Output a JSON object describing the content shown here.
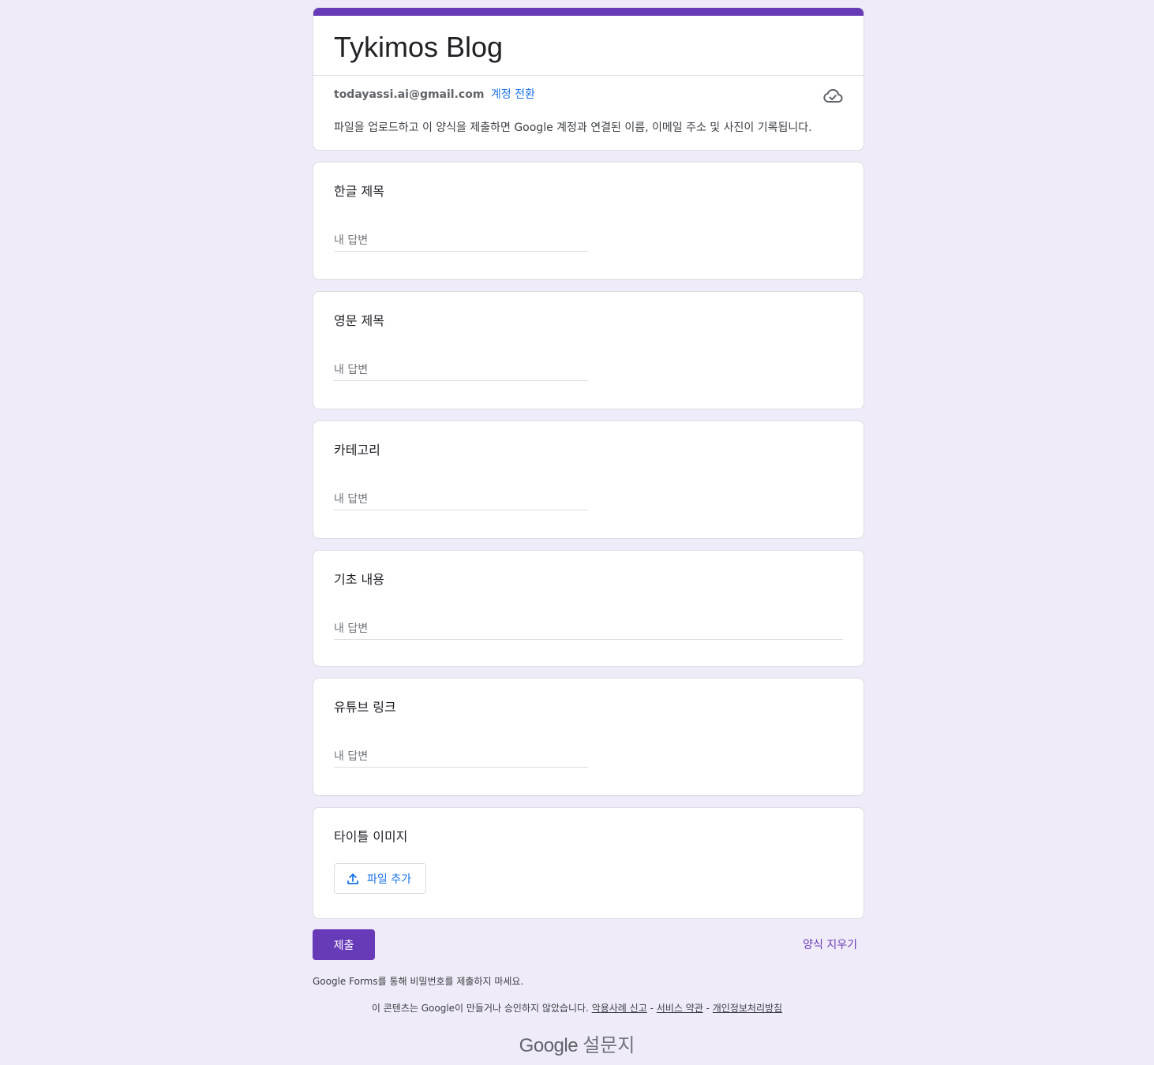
{
  "form": {
    "title": "Tykimos Blog",
    "account_email": "todayassi.ai@gmail.com",
    "switch_account": "계정 전환",
    "notice": "파일을 업로드하고 이 양식을 제출하면 Google 계정과 연결된 이름, 이메일 주소 및 사진이 기록됩니다.",
    "cloud_icon": "cloud-check-icon",
    "accent_color": "#673ab7"
  },
  "questions": [
    {
      "label": "한글 제목",
      "placeholder": "내 답변"
    },
    {
      "label": "영문 제목",
      "placeholder": "내 답변"
    },
    {
      "label": "카테고리",
      "placeholder": "내 답변"
    },
    {
      "label": "기초 내용",
      "placeholder": "내 답변"
    },
    {
      "label": "유튜브 링크",
      "placeholder": "내 답변"
    },
    {
      "label": "타이틀 이미지",
      "button_label": "파일 추가",
      "icon": "upload-icon"
    }
  ],
  "actions": {
    "submit": "제출",
    "clear": "양식 지우기"
  },
  "footer": {
    "password_warning": "Google Forms를 통해 비밀번호를 제출하지 마세요.",
    "disclaimer": "이 콘텐츠는 Google이 만들거나 승인하지 않았습니다.",
    "report_abuse": "악용사례 신고",
    "terms": "서비스 약관",
    "privacy": "개인정보처리방침",
    "separator": "-",
    "brand_google": "Google",
    "brand_product": "설문지"
  }
}
